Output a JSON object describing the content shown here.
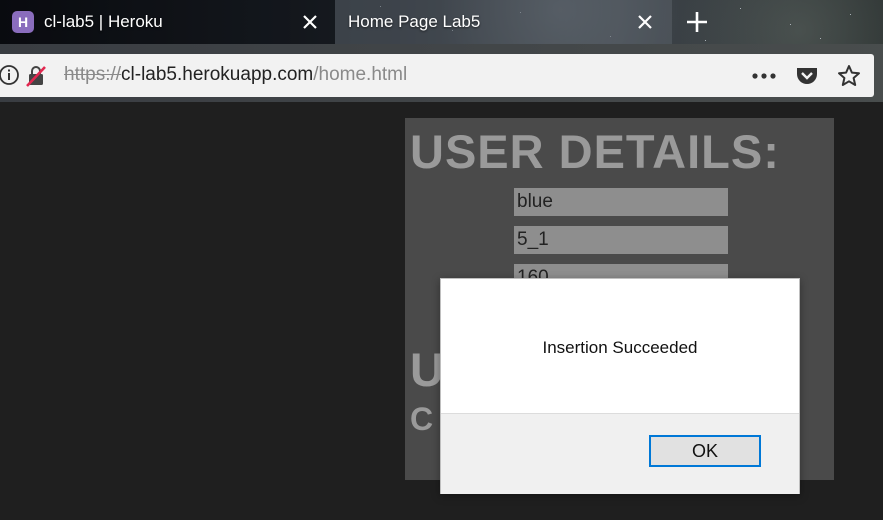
{
  "browser": {
    "tabs": [
      {
        "title": "cl-lab5 | Heroku",
        "favicon": "heroku-icon",
        "favicon_glyph": "H",
        "active": false
      },
      {
        "title": "Home Page Lab5",
        "active": true
      }
    ],
    "url": {
      "scheme": "https://",
      "host": "cl-lab5.herokuapp.com",
      "path": "/home.html"
    },
    "toolbar_icons": [
      "page-info-icon",
      "insecure-lock-icon",
      "more-icon",
      "pocket-icon",
      "bookmark-star-icon",
      "new-tab-icon",
      "close-tab-icon"
    ]
  },
  "page": {
    "heading": "USER DETAILS:",
    "fields": [
      "blue",
      "5_1",
      "160"
    ],
    "heading2_partial": "U",
    "heading3_partial": "C"
  },
  "alert": {
    "message": "Insertion Succeeded",
    "ok_label": "OK"
  },
  "colors": {
    "page_bg": "#1f1f1f",
    "panel_bg": "#4a4a4a",
    "heading": "#9a9a9a",
    "field_bg": "#8e8e8e",
    "ok_border": "#0078d7",
    "favicon_bg": "#8a6dbd"
  }
}
